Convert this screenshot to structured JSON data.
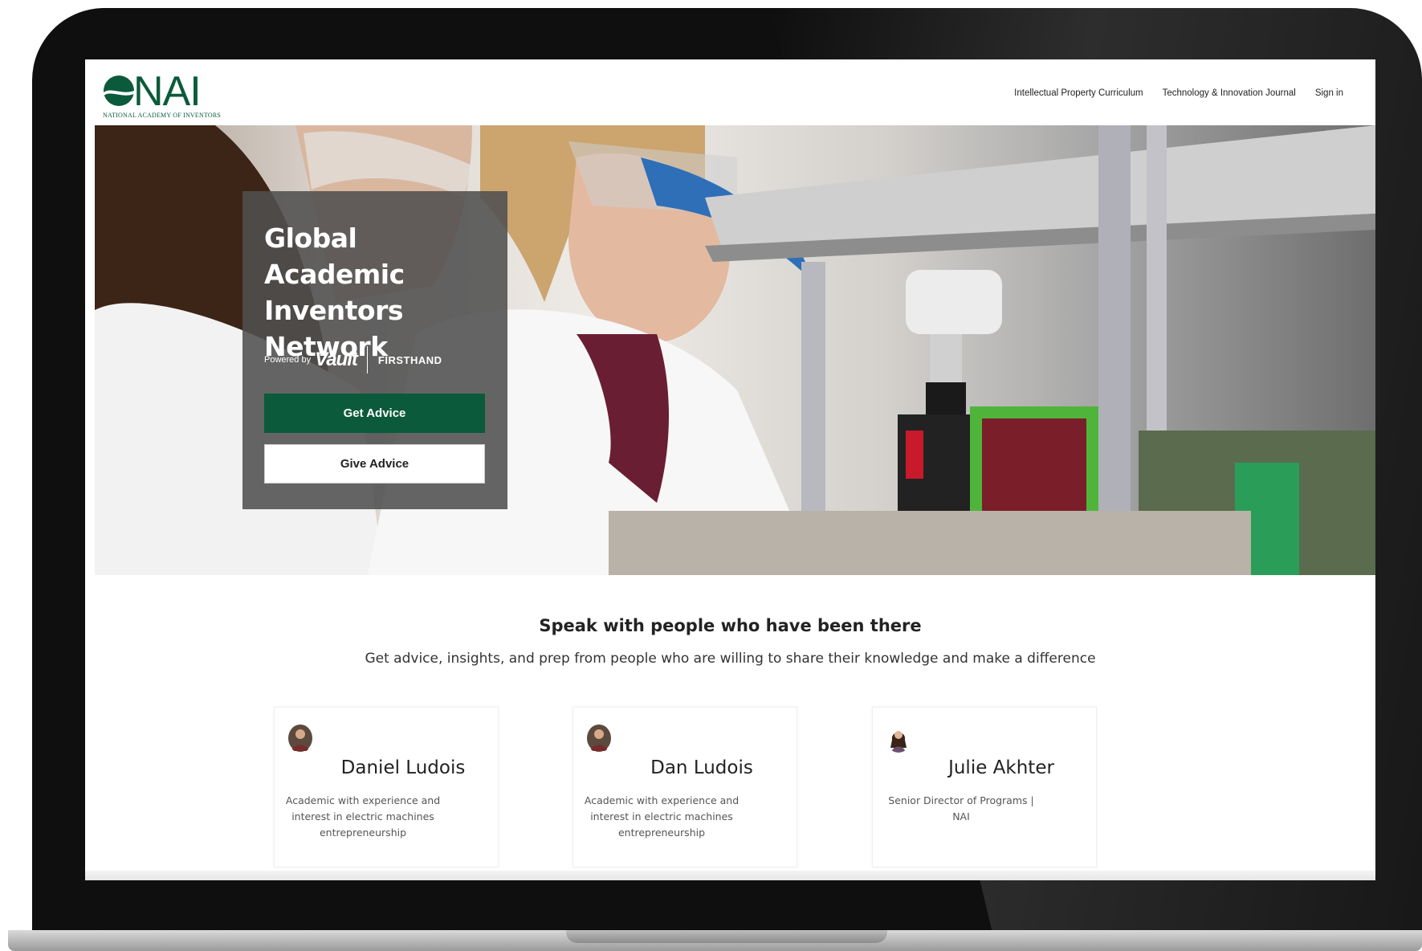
{
  "logo": {
    "text": "NAI",
    "subtitle": "NATIONAL ACADEMY OF INVENTORS",
    "icon": "nai-wave-logo-icon"
  },
  "nav": {
    "items": [
      {
        "label": "Intellectual Property Curriculum"
      },
      {
        "label": "Technology & Innovation Journal"
      },
      {
        "label": "Sign in"
      }
    ]
  },
  "hero": {
    "title": "Global Academic Inventors Network",
    "powered_by": "Powered by",
    "vault": "Vault",
    "firsthand": "FIRSTHAND",
    "get_advice": "Get Advice",
    "give_advice": "Give Advice"
  },
  "section": {
    "title": "Speak with people who have been there",
    "subtitle": "Get advice, insights, and prep from people who are willing to share their knowledge and make a difference"
  },
  "profiles": [
    {
      "name": "Daniel Ludois",
      "description": "Academic with experience and interest in electric machines entrepreneurship",
      "avatar": "person-avatar-icon"
    },
    {
      "name": "Dan Ludois",
      "description": "Academic with experience and interest in electric machines entrepreneurship",
      "avatar": "person-avatar-icon"
    },
    {
      "name": "Julie Akhter",
      "description": "Senior Director of Programs | NAI",
      "avatar": "person-avatar-icon"
    }
  ],
  "colors": {
    "brand_green": "#0b5a3b",
    "card_overlay": "#505050",
    "laptop_frame": "#0f0f0f"
  }
}
